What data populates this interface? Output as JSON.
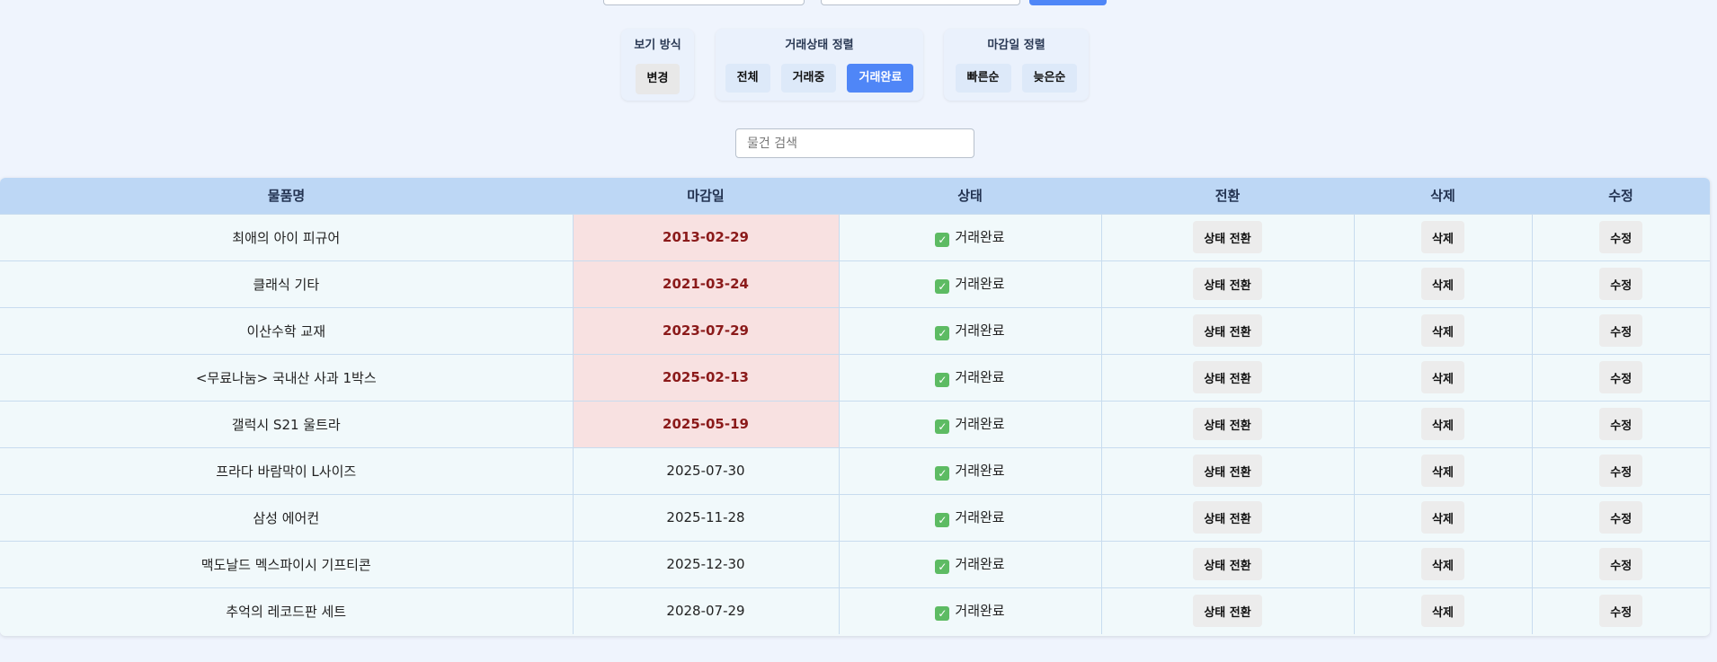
{
  "view_mode": {
    "title": "보기 방식",
    "button": "변경"
  },
  "status_sort": {
    "title": "거래상태 정렬",
    "buttons": [
      "전체",
      "거래중",
      "거래완료"
    ],
    "active": "거래완료"
  },
  "deadline_sort": {
    "title": "마감일 정렬",
    "buttons": [
      "빠른순",
      "늦은순"
    ]
  },
  "search": {
    "placeholder": "물건 검색"
  },
  "table": {
    "headers": [
      "물품명",
      "마감일",
      "상태",
      "전환",
      "삭제",
      "수정"
    ],
    "toggle_label": "상태 전환",
    "delete_label": "삭제",
    "edit_label": "수정",
    "rows": [
      {
        "name": "최애의 아이 피규어",
        "deadline": "2013-02-29",
        "status": "거래완료",
        "overdue": true
      },
      {
        "name": "클래식 기타",
        "deadline": "2021-03-24",
        "status": "거래완료",
        "overdue": true
      },
      {
        "name": "이산수학 교재",
        "deadline": "2023-07-29",
        "status": "거래완료",
        "overdue": true
      },
      {
        "name": "<무료나눔> 국내산 사과 1박스",
        "deadline": "2025-02-13",
        "status": "거래완료",
        "overdue": true
      },
      {
        "name": "갤럭시 S21 울트라",
        "deadline": "2025-05-19",
        "status": "거래완료",
        "overdue": true
      },
      {
        "name": "프라다 바람막이 L사이즈",
        "deadline": "2025-07-30",
        "status": "거래완료",
        "overdue": false
      },
      {
        "name": "삼성 에어컨",
        "deadline": "2025-11-28",
        "status": "거래완료",
        "overdue": false
      },
      {
        "name": "맥도날드 멕스파이시 기프티콘",
        "deadline": "2025-12-30",
        "status": "거래완료",
        "overdue": false
      },
      {
        "name": "추억의 레코드판 세트",
        "deadline": "2028-07-29",
        "status": "거래완료",
        "overdue": false
      }
    ]
  },
  "colors": {
    "accent": "#4f86f7",
    "overdue_bg": "#f8e1e1",
    "overdue_text": "#8b1a1a",
    "header_bg": "#bdd7f5",
    "check": "#5dbb63"
  },
  "icons": {
    "status_icon": "check-box-icon"
  }
}
